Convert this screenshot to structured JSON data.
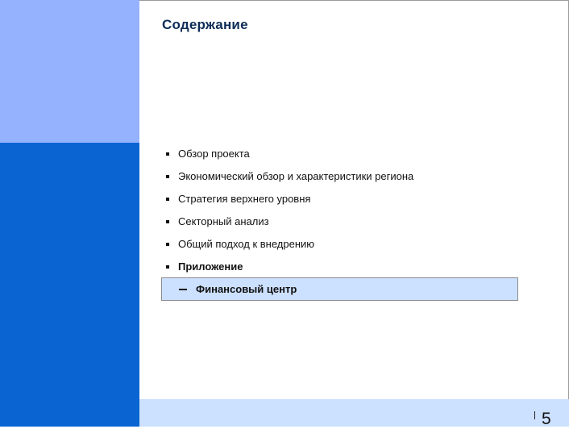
{
  "slide": {
    "title": "Содержание",
    "page_number": "5"
  },
  "agenda": {
    "items": [
      {
        "label": "Обзор проекта",
        "bold": false
      },
      {
        "label": "Экономический обзор и характеристики региона",
        "bold": false
      },
      {
        "label": "Стратегия верхнего уровня",
        "bold": false
      },
      {
        "label": "Секторный анализ",
        "bold": false
      },
      {
        "label": "Общий подход к внедрению",
        "bold": false
      },
      {
        "label": "Приложение",
        "bold": true
      }
    ],
    "sub_item": {
      "label": "Финансовый центр",
      "highlighted": true
    }
  },
  "colors": {
    "sidebar_top": "#95b2ff",
    "sidebar_bottom": "#0a64d2",
    "footer_band": "#cce0ff",
    "title": "#0d2d57",
    "highlight": "#cce0ff"
  }
}
